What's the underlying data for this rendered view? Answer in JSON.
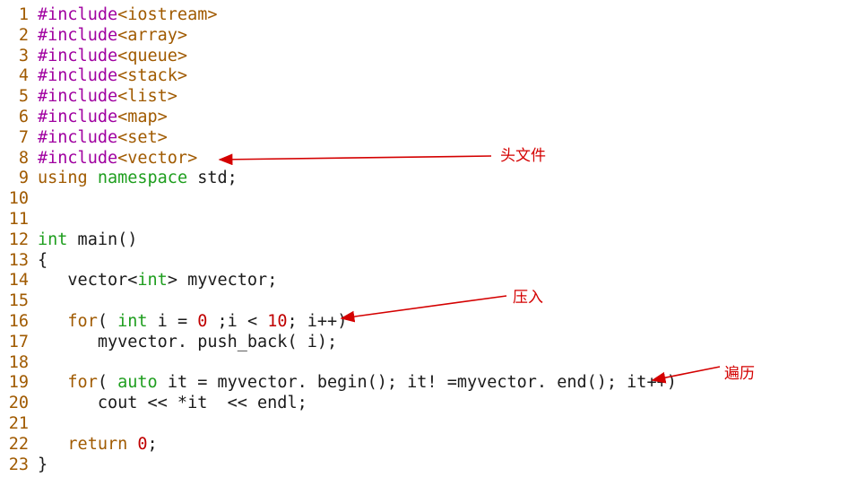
{
  "editor": {
    "lines": [
      {
        "n": "1",
        "parts": [
          {
            "t": "#include",
            "c": "pp"
          },
          {
            "t": "<iostream>",
            "c": "inc"
          }
        ]
      },
      {
        "n": "2",
        "parts": [
          {
            "t": "#include",
            "c": "pp"
          },
          {
            "t": "<array>",
            "c": "inc"
          }
        ]
      },
      {
        "n": "3",
        "parts": [
          {
            "t": "#include",
            "c": "pp"
          },
          {
            "t": "<queue>",
            "c": "inc"
          }
        ]
      },
      {
        "n": "4",
        "parts": [
          {
            "t": "#include",
            "c": "pp"
          },
          {
            "t": "<stack>",
            "c": "inc"
          }
        ]
      },
      {
        "n": "5",
        "parts": [
          {
            "t": "#include",
            "c": "pp"
          },
          {
            "t": "<list>",
            "c": "inc"
          }
        ]
      },
      {
        "n": "6",
        "parts": [
          {
            "t": "#include",
            "c": "pp"
          },
          {
            "t": "<map>",
            "c": "inc"
          }
        ]
      },
      {
        "n": "7",
        "parts": [
          {
            "t": "#include",
            "c": "pp"
          },
          {
            "t": "<set>",
            "c": "inc"
          }
        ]
      },
      {
        "n": "8",
        "parts": [
          {
            "t": "#include",
            "c": "pp"
          },
          {
            "t": "<vector>",
            "c": "inc"
          }
        ]
      },
      {
        "n": "9",
        "parts": [
          {
            "t": "using",
            "c": "kw"
          },
          {
            "t": " ",
            "c": ""
          },
          {
            "t": "namespace",
            "c": "ns"
          },
          {
            "t": " std;",
            "c": ""
          }
        ]
      },
      {
        "n": "10",
        "parts": []
      },
      {
        "n": "11",
        "parts": []
      },
      {
        "n": "12",
        "parts": [
          {
            "t": "int",
            "c": "type"
          },
          {
            "t": " main()",
            "c": ""
          }
        ]
      },
      {
        "n": "13",
        "parts": [
          {
            "t": "{",
            "c": ""
          }
        ]
      },
      {
        "n": "14",
        "parts": [
          {
            "t": "   vector<",
            "c": ""
          },
          {
            "t": "int",
            "c": "type"
          },
          {
            "t": "> myvector;",
            "c": ""
          }
        ]
      },
      {
        "n": "15",
        "parts": []
      },
      {
        "n": "16",
        "parts": [
          {
            "t": "   ",
            "c": ""
          },
          {
            "t": "for",
            "c": "kw"
          },
          {
            "t": "( ",
            "c": ""
          },
          {
            "t": "int",
            "c": "type"
          },
          {
            "t": " i = ",
            "c": ""
          },
          {
            "t": "0",
            "c": "num"
          },
          {
            "t": " ;i < ",
            "c": ""
          },
          {
            "t": "10",
            "c": "num"
          },
          {
            "t": "; i++)",
            "c": ""
          }
        ]
      },
      {
        "n": "17",
        "parts": [
          {
            "t": "      myvector. push_back( i);",
            "c": ""
          }
        ]
      },
      {
        "n": "18",
        "parts": []
      },
      {
        "n": "19",
        "parts": [
          {
            "t": "   ",
            "c": ""
          },
          {
            "t": "for",
            "c": "kw"
          },
          {
            "t": "( ",
            "c": ""
          },
          {
            "t": "auto",
            "c": "type"
          },
          {
            "t": " it = myvector. begin(); it! =myvector. end(); it++)",
            "c": ""
          }
        ]
      },
      {
        "n": "20",
        "parts": [
          {
            "t": "      cout << *it  << endl;",
            "c": ""
          }
        ]
      },
      {
        "n": "21",
        "parts": []
      },
      {
        "n": "22",
        "parts": [
          {
            "t": "   ",
            "c": ""
          },
          {
            "t": "return",
            "c": "kw"
          },
          {
            "t": " ",
            "c": ""
          },
          {
            "t": "0",
            "c": "num"
          },
          {
            "t": ";",
            "c": ""
          }
        ]
      },
      {
        "n": "23",
        "parts": [
          {
            "t": "}",
            "c": ""
          }
        ]
      }
    ]
  },
  "annotations": {
    "header": "头文件",
    "push": "压入",
    "traverse": "遍历"
  },
  "colors": {
    "annotation": "#d40000",
    "line_number": "#a05a00",
    "preprocessor": "#a000a0",
    "type": "#1e9e1e",
    "number": "#c00000"
  }
}
